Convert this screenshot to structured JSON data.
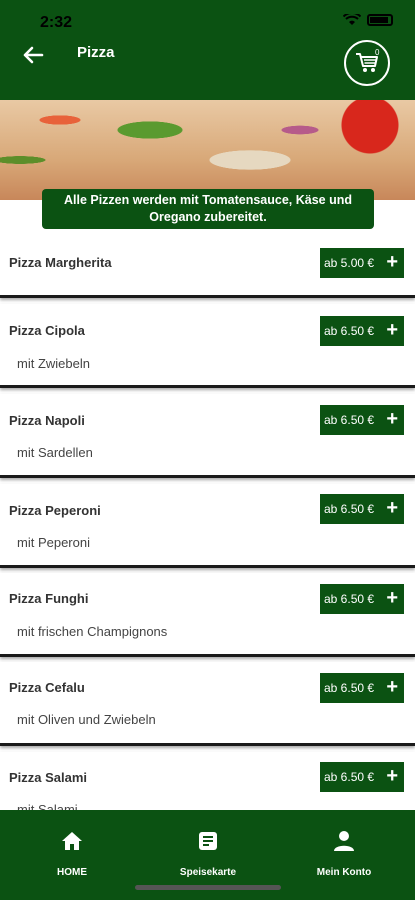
{
  "status_bar": {
    "time": "2:32"
  },
  "header": {
    "title": "Pizza",
    "cart_count": "0"
  },
  "banner": {
    "note": "Alle Pizzen werden mit Tomatensauce, Käse und Oregano zubereitet."
  },
  "items": [
    {
      "name": "Pizza Margherita",
      "desc": "",
      "price": "ab 5.00 €"
    },
    {
      "name": "Pizza Cipola",
      "desc": "mit Zwiebeln",
      "price": "ab 6.50 €"
    },
    {
      "name": "Pizza Napoli",
      "desc": "mit Sardellen",
      "price": "ab 6.50 €"
    },
    {
      "name": "Pizza Peperoni",
      "desc": "mit Peperoni",
      "price": "ab 6.50 €"
    },
    {
      "name": "Pizza Funghi",
      "desc": "mit frischen Champignons",
      "price": "ab 6.50 €"
    },
    {
      "name": "Pizza Cefalu",
      "desc": "mit Oliven und Zwiebeln",
      "price": "ab 6.50 €"
    },
    {
      "name": "Pizza Salami",
      "desc": "mit Salami",
      "price": "ab 6.50 €"
    }
  ],
  "nav": [
    {
      "label": "HOME",
      "icon": "home-icon"
    },
    {
      "label": "Speisekarte",
      "icon": "menu-card-icon"
    },
    {
      "label": "Mein Konto",
      "icon": "user-icon"
    }
  ],
  "colors": {
    "brand_green": "#0b5212"
  }
}
